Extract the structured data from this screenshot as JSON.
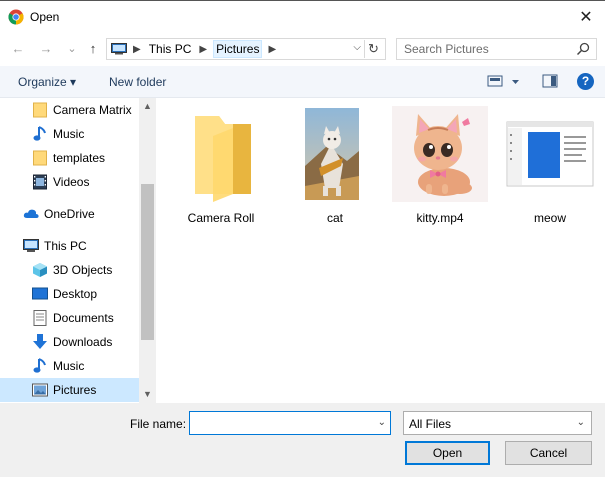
{
  "window": {
    "title": "Open",
    "app_icon": "chrome-icon",
    "close_glyph": "✕"
  },
  "nav": {
    "back_glyph": "←",
    "forward_glyph": "→",
    "recent_glyph": "⌄",
    "up_glyph": "↑",
    "breadcrumb": [
      "This PC",
      "Pictures"
    ],
    "search_placeholder": "Search Pictures"
  },
  "toolbar": {
    "organize_label": "Organize ▾",
    "new_folder_label": "New folder",
    "help_glyph": "?"
  },
  "sidebar": {
    "items": [
      {
        "label": "Camera Matrix",
        "icon": "folder-icon",
        "indent": 1
      },
      {
        "label": "Music",
        "icon": "music-icon",
        "indent": 1
      },
      {
        "label": "templates",
        "icon": "folder-icon",
        "indent": 1
      },
      {
        "label": "Videos",
        "icon": "videos-icon",
        "indent": 1
      },
      {
        "label": "OneDrive",
        "icon": "cloud-icon",
        "indent": 0
      },
      {
        "label": "This PC",
        "icon": "pc-icon",
        "indent": 0
      },
      {
        "label": "3D Objects",
        "icon": "cube-icon",
        "indent": 1
      },
      {
        "label": "Desktop",
        "icon": "desktop-icon",
        "indent": 1
      },
      {
        "label": "Documents",
        "icon": "documents-icon",
        "indent": 1
      },
      {
        "label": "Downloads",
        "icon": "downloads-icon",
        "indent": 1
      },
      {
        "label": "Music",
        "icon": "music-icon",
        "indent": 1
      },
      {
        "label": "Pictures",
        "icon": "pictures-icon",
        "indent": 1,
        "selected": true
      }
    ]
  },
  "files": [
    {
      "name": "Camera Roll",
      "type": "folder-icon"
    },
    {
      "name": "cat",
      "type": "cat-image-thumbnail"
    },
    {
      "name": "kitty.mp4",
      "type": "kitty-video-thumbnail"
    },
    {
      "name": "meow",
      "type": "screenshot-thumbnail"
    }
  ],
  "footer": {
    "filename_label": "File name:",
    "filename_value": "",
    "filetype_value": "All Files",
    "open_label": "Open",
    "cancel_label": "Cancel"
  },
  "colors": {
    "selection": "#cce8ff",
    "accent": "#0078d7",
    "folder": "#ffd97a",
    "toolbar_bg": "#f3f6fb",
    "footer_bg": "#f0f0f0"
  }
}
